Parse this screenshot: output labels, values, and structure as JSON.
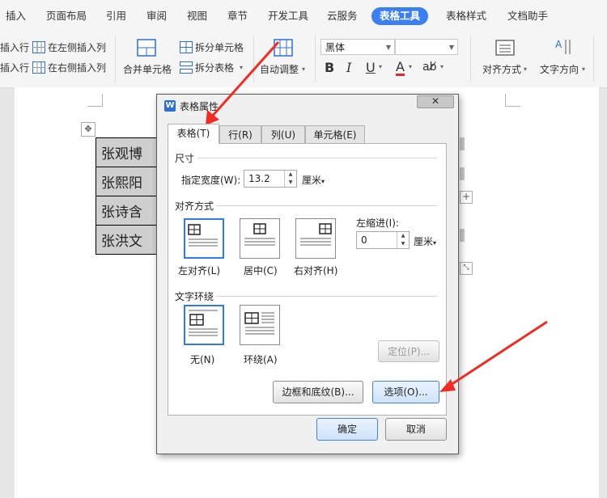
{
  "ribbon_tabs": [
    {
      "label": "插入"
    },
    {
      "label": "页面布局"
    },
    {
      "label": "引用"
    },
    {
      "label": "审阅"
    },
    {
      "label": "视图"
    },
    {
      "label": "章节"
    },
    {
      "label": "开发工具"
    },
    {
      "label": "云服务"
    },
    {
      "label": "表格工具",
      "active": true
    },
    {
      "label": "表格样式"
    },
    {
      "label": "文档助手"
    }
  ],
  "ribbon": {
    "insert_row_above": "插入行",
    "insert_row_below": "插入行",
    "insert_col_left": "在左侧插入列",
    "insert_col_right": "在右侧插入列",
    "merge_cells": "合并单元格",
    "split_cells": "拆分单元格",
    "split_table": "拆分表格",
    "auto_fit": "自动调整",
    "font_name": "黑体",
    "font_size": "",
    "align": "对齐方式",
    "text_direction": "文字方向"
  },
  "doc_table": {
    "rows": [
      "张观博",
      "张熙阳",
      "张诗含",
      "张洪文"
    ]
  },
  "dialog": {
    "title": "表格属性",
    "tabs": [
      "表格(T)",
      "行(R)",
      "列(U)",
      "单元格(E)"
    ],
    "size_section": "尺寸",
    "width_label": "指定宽度(W):",
    "width_value": "13.2",
    "width_unit": "厘米",
    "align_section": "对齐方式",
    "align_left": "左对齐(L)",
    "align_center": "居中(C)",
    "align_right": "右对齐(H)",
    "indent_label": "左缩进(I):",
    "indent_value": "0",
    "indent_unit": "厘米",
    "wrap_section": "文字环绕",
    "wrap_none": "无(N)",
    "wrap_around": "环绕(A)",
    "position_button": "定位(P)...",
    "borders_button": "边框和底纹(B)...",
    "options_button": "选项(O)...",
    "ok_button": "确定",
    "cancel_button": "取消"
  },
  "colors": {
    "accent": "#3b7ff0",
    "arrow": "#ee2d24"
  }
}
